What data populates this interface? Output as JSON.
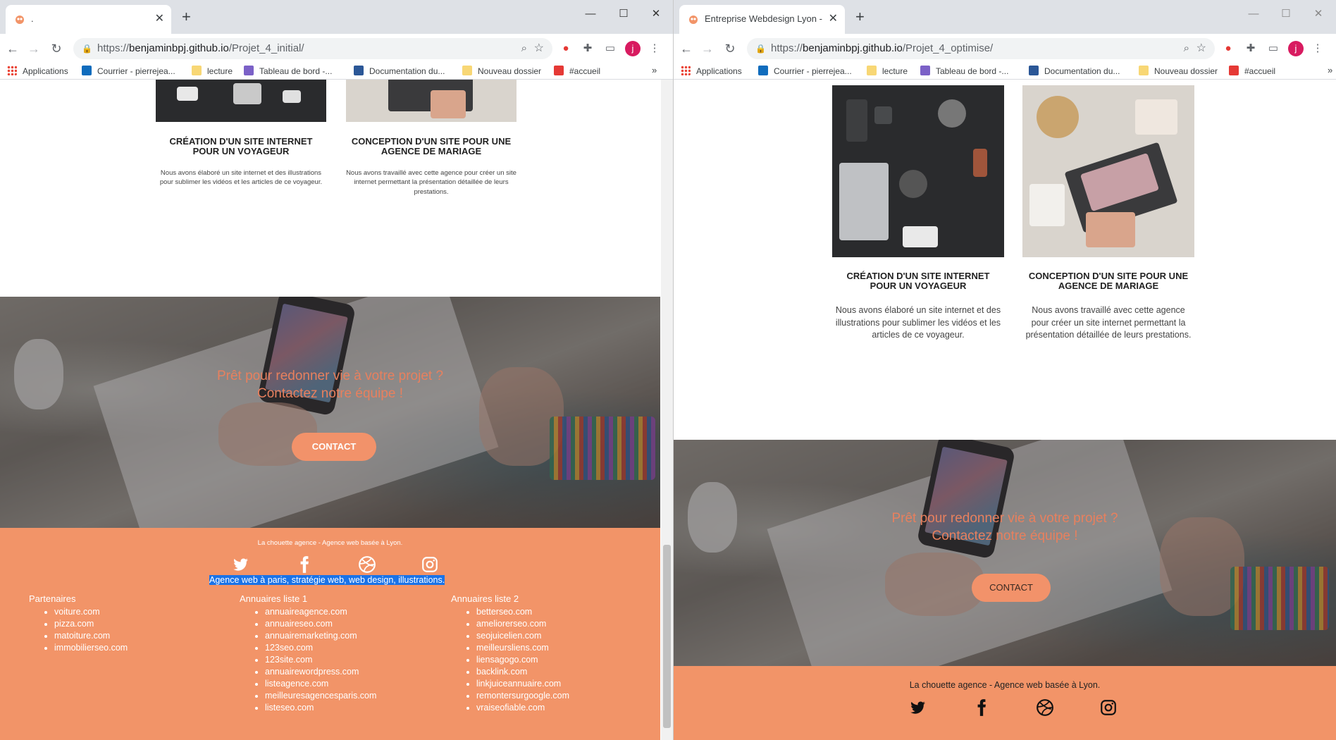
{
  "left": {
    "tab_title": ".",
    "url_scheme": "https://",
    "url_host": "benjaminbpj.github.io",
    "url_path": "/Projet_4_initial/"
  },
  "right": {
    "tab_title": "Entreprise Webdesign Lyon - La C",
    "url_scheme": "https://",
    "url_host": "benjaminbpj.github.io",
    "url_path": "/Projet_4_optimise/"
  },
  "bookmarks": [
    "Applications",
    "Courrier - pierrejea...",
    "lecture",
    "Tableau de bord -...",
    "Documentation du...",
    "Nouveau dossier",
    "#accueil"
  ],
  "avatar_letter": "j",
  "icons": {
    "back": "←",
    "forward": "→",
    "reload": "↻",
    "lock": "🔒",
    "zoom": "⌕",
    "star": "☆",
    "close": "✕",
    "new_tab": "+",
    "minimize": "—",
    "maximize": "☐",
    "window_close": "✕",
    "more": "⋮",
    "chevron": "»"
  },
  "projects": [
    {
      "title": "CRÉATION D'UN SITE INTERNET POUR UN VOYAGEUR",
      "desc": "Nous avons élaboré un site internet et des illustrations pour sublimer les vidéos et les articles de ce voyageur."
    },
    {
      "title": "CONCEPTION D'UN SITE POUR UNE AGENCE DE MARIAGE",
      "desc_left": "Nous avons travaillé avec cette agence pour créer un site internet permettant la présentation détaillée de leurs prestations.",
      "desc_right": "Nous avons travaillé avec cette agence pour créer un site internet permettant la présentation détaillée de leurs prestations."
    }
  ],
  "hero": {
    "line1": "Prêt pour redonner vie à votre projet ?",
    "line2": "Contactez notre équipe !",
    "button": "CONTACT"
  },
  "footer": {
    "tagline": "La chouette agence - Agence web basée à Lyon.",
    "seo_text": "Agence web à paris, stratégie web, web design, illustrations.",
    "social": [
      "twitter-icon",
      "facebook-icon",
      "dribbble-icon",
      "instagram-icon"
    ],
    "columns": [
      {
        "title": "Partenaires",
        "items": [
          "voiture.com",
          "pizza.com",
          "matoiture.com",
          "immobilierseo.com"
        ]
      },
      {
        "title": "Annuaires liste 1",
        "items": [
          "annuaireagence.com",
          "annuaireseo.com",
          "annuairemarketing.com",
          "123seo.com",
          "123site.com",
          "annuairewordpress.com",
          "listeagence.com",
          "meilleuresagencesparis.com",
          "listeseo.com"
        ]
      },
      {
        "title": "Annuaires liste 2",
        "items": [
          "betterseo.com",
          "ameliorerseo.com",
          "seojuicelien.com",
          "meilleursliens.com",
          "liensagogo.com",
          "backlink.com",
          "linkjuiceannuaire.com",
          "remontersurgoogle.com",
          "vraiseofiable.com"
        ]
      }
    ]
  },
  "colors": {
    "accent": "#f29468",
    "hero_text": "#e8805e",
    "selection": "#1a73e8"
  }
}
